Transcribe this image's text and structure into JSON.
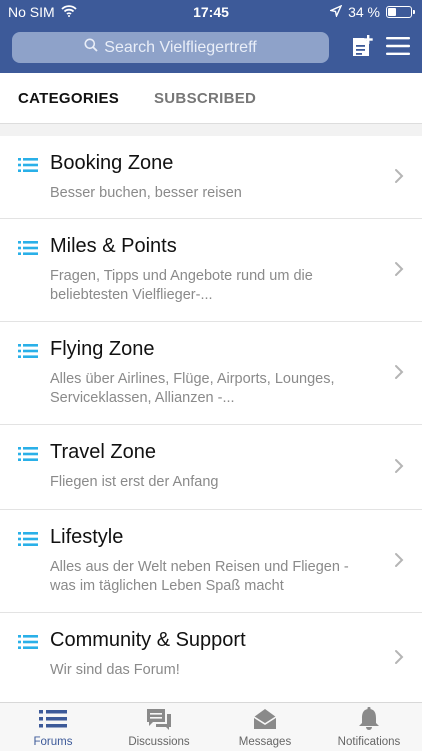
{
  "status": {
    "carrier": "No SIM",
    "time": "17:45",
    "battery": "34 %",
    "battery_level": 0.34
  },
  "header": {
    "search_placeholder": "Search Vielfliegertreff",
    "compose_icon": "new-post-icon",
    "menu_icon": "hamburger-menu-icon",
    "bar_color": "#3d5a99"
  },
  "tabs": [
    {
      "label": "CATEGORIES",
      "active": true
    },
    {
      "label": "SUBSCRIBED",
      "active": false
    }
  ],
  "categories": [
    {
      "title": "Booking Zone",
      "desc": "Besser buchen, besser reisen"
    },
    {
      "title": "Miles & Points",
      "desc": "Fragen, Tipps und Angebote rund um die beliebtesten Vielflieger-..."
    },
    {
      "title": "Flying Zone",
      "desc": "Alles über Airlines, Flüge, Airports, Lounges, Serviceklassen, Allianzen -..."
    },
    {
      "title": "Travel Zone",
      "desc": "Fliegen ist erst der Anfang"
    },
    {
      "title": "Lifestyle",
      "desc": "Alles aus der Welt neben Reisen und Fliegen - was im täglichen Leben Spaß macht"
    },
    {
      "title": "Community & Support",
      "desc": "Wir sind das Forum!"
    }
  ],
  "bottom_nav": [
    {
      "label": "Forums",
      "icon": "list-icon",
      "active": true
    },
    {
      "label": "Discussions",
      "icon": "chat-bubbles-icon",
      "active": false
    },
    {
      "label": "Messages",
      "icon": "envelope-icon",
      "active": false
    },
    {
      "label": "Notifications",
      "icon": "bell-icon",
      "active": false
    }
  ],
  "colors": {
    "accent": "#3d5a99",
    "list_icon": "#2ab0e8"
  }
}
